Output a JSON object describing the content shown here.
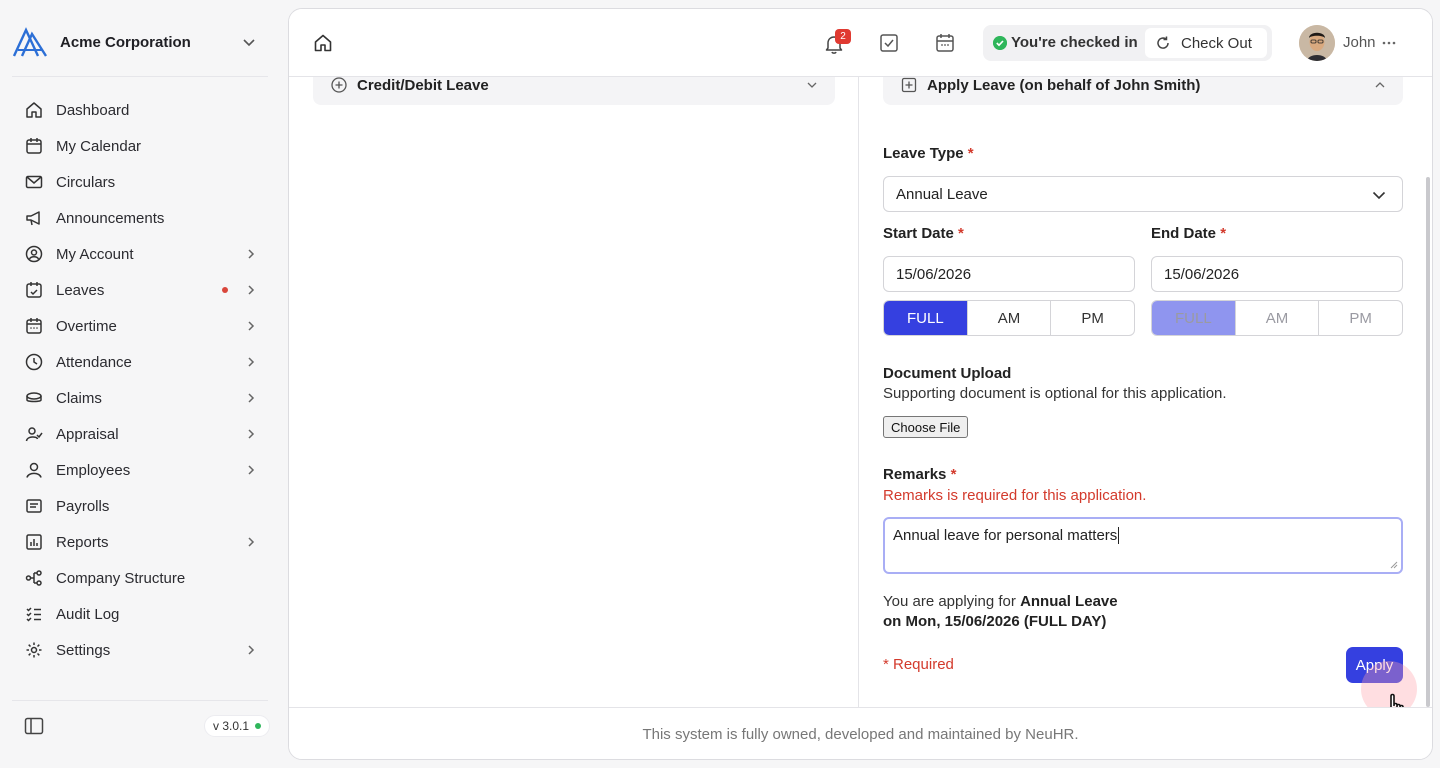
{
  "org": {
    "name": "Acme Corporation"
  },
  "sidebar": {
    "items": [
      {
        "label": "Dashboard",
        "icon": "home-icon",
        "chevron": false
      },
      {
        "label": "My Calendar",
        "icon": "calendar-icon",
        "chevron": false
      },
      {
        "label": "Circulars",
        "icon": "mail-icon",
        "chevron": false
      },
      {
        "label": "Announcements",
        "icon": "megaphone-icon",
        "chevron": false
      },
      {
        "label": "My Account",
        "icon": "user-circle-icon",
        "chevron": true
      },
      {
        "label": "Leaves",
        "icon": "calendar-check-icon",
        "chevron": true,
        "dot": true
      },
      {
        "label": "Overtime",
        "icon": "calendar-clock-icon",
        "chevron": true
      },
      {
        "label": "Attendance",
        "icon": "clock-icon",
        "chevron": true
      },
      {
        "label": "Claims",
        "icon": "coins-icon",
        "chevron": true
      },
      {
        "label": "Appraisal",
        "icon": "user-check-icon",
        "chevron": true
      },
      {
        "label": "Employees",
        "icon": "user-icon",
        "chevron": true
      },
      {
        "label": "Payrolls",
        "icon": "receipt-icon",
        "chevron": false
      },
      {
        "label": "Reports",
        "icon": "chart-icon",
        "chevron": true
      },
      {
        "label": "Company Structure",
        "icon": "tree-icon",
        "chevron": false
      },
      {
        "label": "Audit Log",
        "icon": "list-check-icon",
        "chevron": false
      },
      {
        "label": "Settings",
        "icon": "gear-icon",
        "chevron": true
      }
    ],
    "version": "v 3.0.1"
  },
  "topbar": {
    "notification_count": "2",
    "checkin_status": "You're checked in",
    "checkout_label": "Check Out",
    "user_name": "John"
  },
  "left_panel": {
    "accordion_label": "Credit/Debit Leave"
  },
  "form": {
    "accordion_label": "Apply Leave (on behalf of John Smith)",
    "leave_type_label": "Leave Type",
    "leave_type_value": "Annual Leave",
    "start_date_label": "Start Date",
    "start_date_value": "15/06/2026",
    "end_date_label": "End Date",
    "end_date_value": "15/06/2026",
    "day_parts": [
      "FULL",
      "AM",
      "PM"
    ],
    "document_title": "Document Upload",
    "document_sub": "Supporting document is optional for this application.",
    "choose_file": "Choose File",
    "remarks_label": "Remarks",
    "remarks_error": "Remarks is required for this application.",
    "remarks_value": "Annual leave for personal matters",
    "summary_prefix": "You are applying for",
    "summary_type": "Annual Leave",
    "summary_date": "on Mon, 15/06/2026 (FULL DAY)",
    "required_note": "* Required",
    "apply_label": "Apply",
    "required_mark": "*"
  },
  "footer": {
    "text": "This system is fully owned, developed and maintained by NeuHR."
  },
  "colors": {
    "accent": "#3540e0",
    "error": "#d33a2c",
    "success": "#2fb65b"
  }
}
